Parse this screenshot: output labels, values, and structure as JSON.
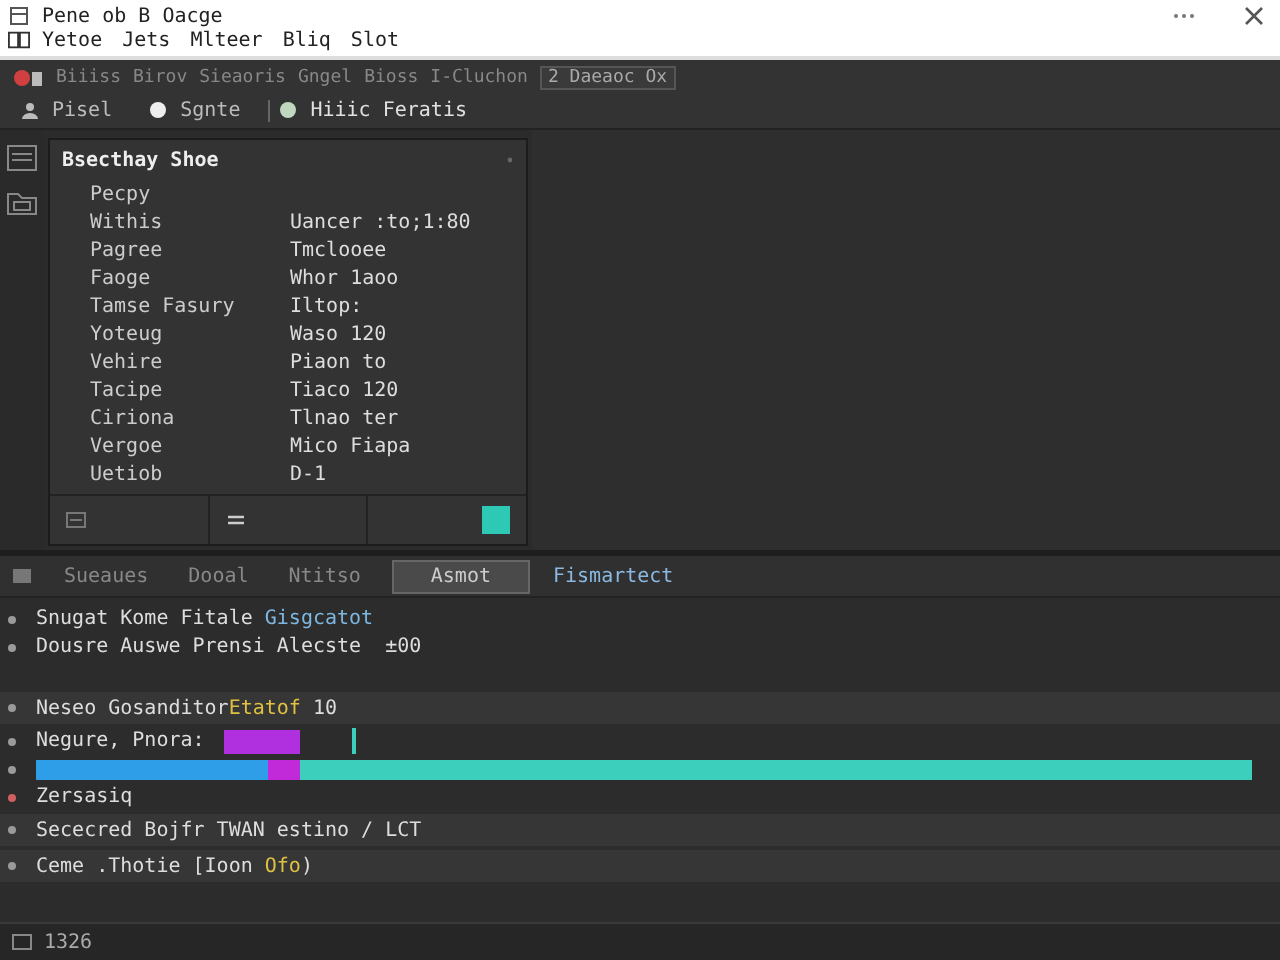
{
  "window": {
    "title": "Pene ob B Oacge"
  },
  "menu": [
    "Yetoe",
    "Jets",
    "Mlteer",
    "Bliq",
    "Slot"
  ],
  "toolbar": {
    "items": [
      "Biiiss",
      "Birov",
      "Sieaoris",
      "Gngel",
      "Bioss",
      "I-Cluchon"
    ],
    "badge": "2 Daeaoc Ox"
  },
  "views": [
    {
      "label": "Pisel",
      "kind": "person",
      "selected": false
    },
    {
      "label": "Sgnte",
      "kind": "dot",
      "selected": false
    },
    {
      "label": "Hiiic Feratis",
      "kind": "ring",
      "selected": true
    }
  ],
  "panel": {
    "title": "Bsecthay Shoe",
    "header": "Pecpy",
    "rows": [
      {
        "label": "Withis",
        "value": "Uancer :to;1:80"
      },
      {
        "label": "Pagree",
        "value": "Tmclooee"
      },
      {
        "label": "Faoge",
        "value": "Whor 1aoo"
      },
      {
        "label": "Tamse Fasury",
        "value": "Iltop:"
      },
      {
        "label": "Yoteug",
        "value": "Waso 120"
      },
      {
        "label": "Vehire",
        "value": "Piaon to"
      },
      {
        "label": "Tacipe",
        "value": "Tiaco 120"
      },
      {
        "label": "Ciriona",
        "value": "Tlnao ter"
      },
      {
        "label": "Vergoe",
        "value": "Mico Fiapa"
      },
      {
        "label": "Uetiob",
        "value": "D-1"
      }
    ],
    "swatch": {
      "color": "#2ec9b5"
    }
  },
  "bottom": {
    "tabs": [
      {
        "label": "Sueaues",
        "selected": false
      },
      {
        "label": "Dooal",
        "selected": false
      },
      {
        "label": "Ntitso",
        "selected": false
      },
      {
        "label": "Asmot",
        "selected": true
      }
    ],
    "link": "Fismartect",
    "lines": [
      {
        "kind": "text",
        "spans": [
          {
            "kind": "plain",
            "text": "Snugat Kome Fitale "
          },
          {
            "kind": "link",
            "text": "Gisgcatot"
          }
        ],
        "error": false
      },
      {
        "kind": "text",
        "spans": [
          {
            "kind": "plain",
            "text": "Dousre Auswe Prensi Alecste  ±00"
          }
        ],
        "error": false
      },
      {
        "kind": "blank"
      },
      {
        "kind": "text",
        "spans": [
          {
            "kind": "plain",
            "text": "Neseo Gosanditor"
          },
          {
            "kind": "string",
            "text": "Etatof"
          },
          {
            "kind": "plain",
            "text": " 10"
          }
        ],
        "error": false,
        "highlighted": true
      },
      {
        "kind": "clip",
        "text": "Negure, Pnora:",
        "error": false
      },
      {
        "kind": "timeline",
        "error": false,
        "level": 0.19
      },
      {
        "kind": "text",
        "spans": [
          {
            "kind": "plain",
            "text": "Zersasiq"
          }
        ],
        "error": true
      },
      {
        "kind": "text",
        "spans": [
          {
            "kind": "plain",
            "text": "Sececred Bojfr TWAN estino / LCT"
          }
        ],
        "error": false,
        "highlighted": true
      },
      {
        "kind": "text",
        "spans": [
          {
            "kind": "plain",
            "text": "Ceme .Thotie [Ioon "
          },
          {
            "kind": "string",
            "text": "Ofo"
          },
          {
            "kind": "plain",
            "text": ")"
          }
        ],
        "error": false,
        "highlighted": true
      }
    ]
  },
  "status_bar": {
    "text": "1326"
  }
}
